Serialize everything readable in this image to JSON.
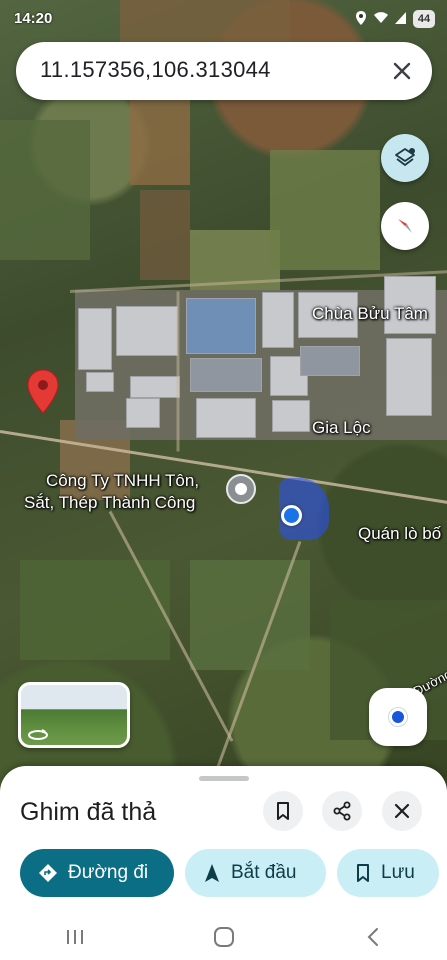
{
  "status": {
    "time": "14:20",
    "battery": "44",
    "icons": [
      "location-icon",
      "wifi-icon",
      "signal-icon",
      "battery-icon"
    ]
  },
  "search": {
    "value": "11.157356,106.313044"
  },
  "map": {
    "labels": {
      "chua_buu_tam": "Chùa Bửu Tâm",
      "gia_loc": "Gia Lộc",
      "company_line1": "Công Ty TNHH Tôn,",
      "company_line2": "Sắt, Thép Thành Công",
      "quan_lo": "Quán lò bố",
      "duong": "Đường"
    }
  },
  "sheet": {
    "title": "Ghim đã thả",
    "actions": {
      "directions": "Đường đi",
      "start": "Bắt đầu",
      "save": "Lưu"
    }
  },
  "colors": {
    "primary": "#0b6e84",
    "secondary": "#c9eef6",
    "pin_red": "#e53935",
    "location_blue": "#1a73e8"
  }
}
